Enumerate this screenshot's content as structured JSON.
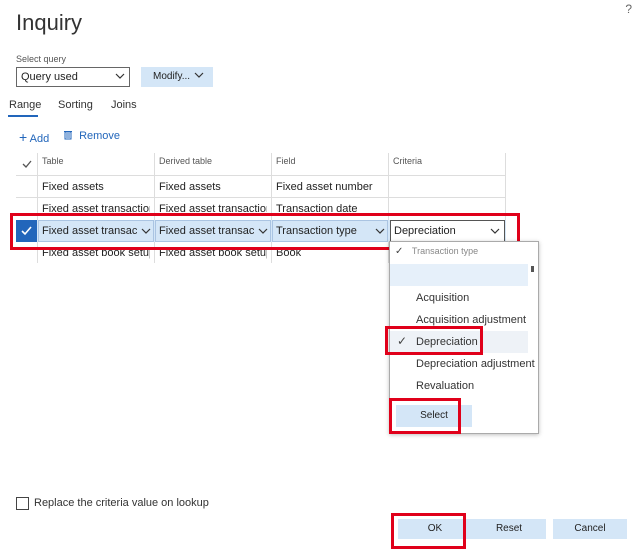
{
  "window": {
    "title": "Inquiry",
    "help_label": "?"
  },
  "query": {
    "label": "Select query",
    "selected": "Query used",
    "modify_label": "Modify..."
  },
  "tabs": [
    {
      "label": "Range"
    },
    {
      "label": "Sorting"
    },
    {
      "label": "Joins"
    }
  ],
  "actions": {
    "add_label": "Add",
    "remove_label": "Remove"
  },
  "grid": {
    "columns": [
      "Table",
      "Derived table",
      "Field",
      "Criteria"
    ],
    "rows": [
      {
        "table": "Fixed assets",
        "derived": "Fixed assets",
        "field": "Fixed asset number",
        "criteria": ""
      },
      {
        "table": "Fixed asset transactions",
        "derived": "Fixed asset transactions",
        "field": "Transaction date",
        "criteria": ""
      },
      {
        "table": "Fixed asset transacti...",
        "derived": "Fixed asset transacti...",
        "field": "Transaction type",
        "criteria": "Depreciation",
        "selected": true
      },
      {
        "table": "Fixed asset book setup...",
        "derived": "Fixed asset book setup...",
        "field": "Book",
        "criteria": ""
      }
    ]
  },
  "dropdown": {
    "header": "Transaction type",
    "options": [
      "Acquisition",
      "Acquisition adjustment",
      "Depreciation",
      "Depreciation adjustment",
      "Revaluation"
    ],
    "checked_option": "Depreciation",
    "select_label": "Select"
  },
  "footer": {
    "replace_label": "Replace the criteria value on lookup",
    "ok_label": "OK",
    "reset_label": "Reset",
    "cancel_label": "Cancel"
  },
  "colors": {
    "accent": "#2266bb",
    "selection": "#d4e6f7",
    "highlight_border": "#e0001a"
  }
}
